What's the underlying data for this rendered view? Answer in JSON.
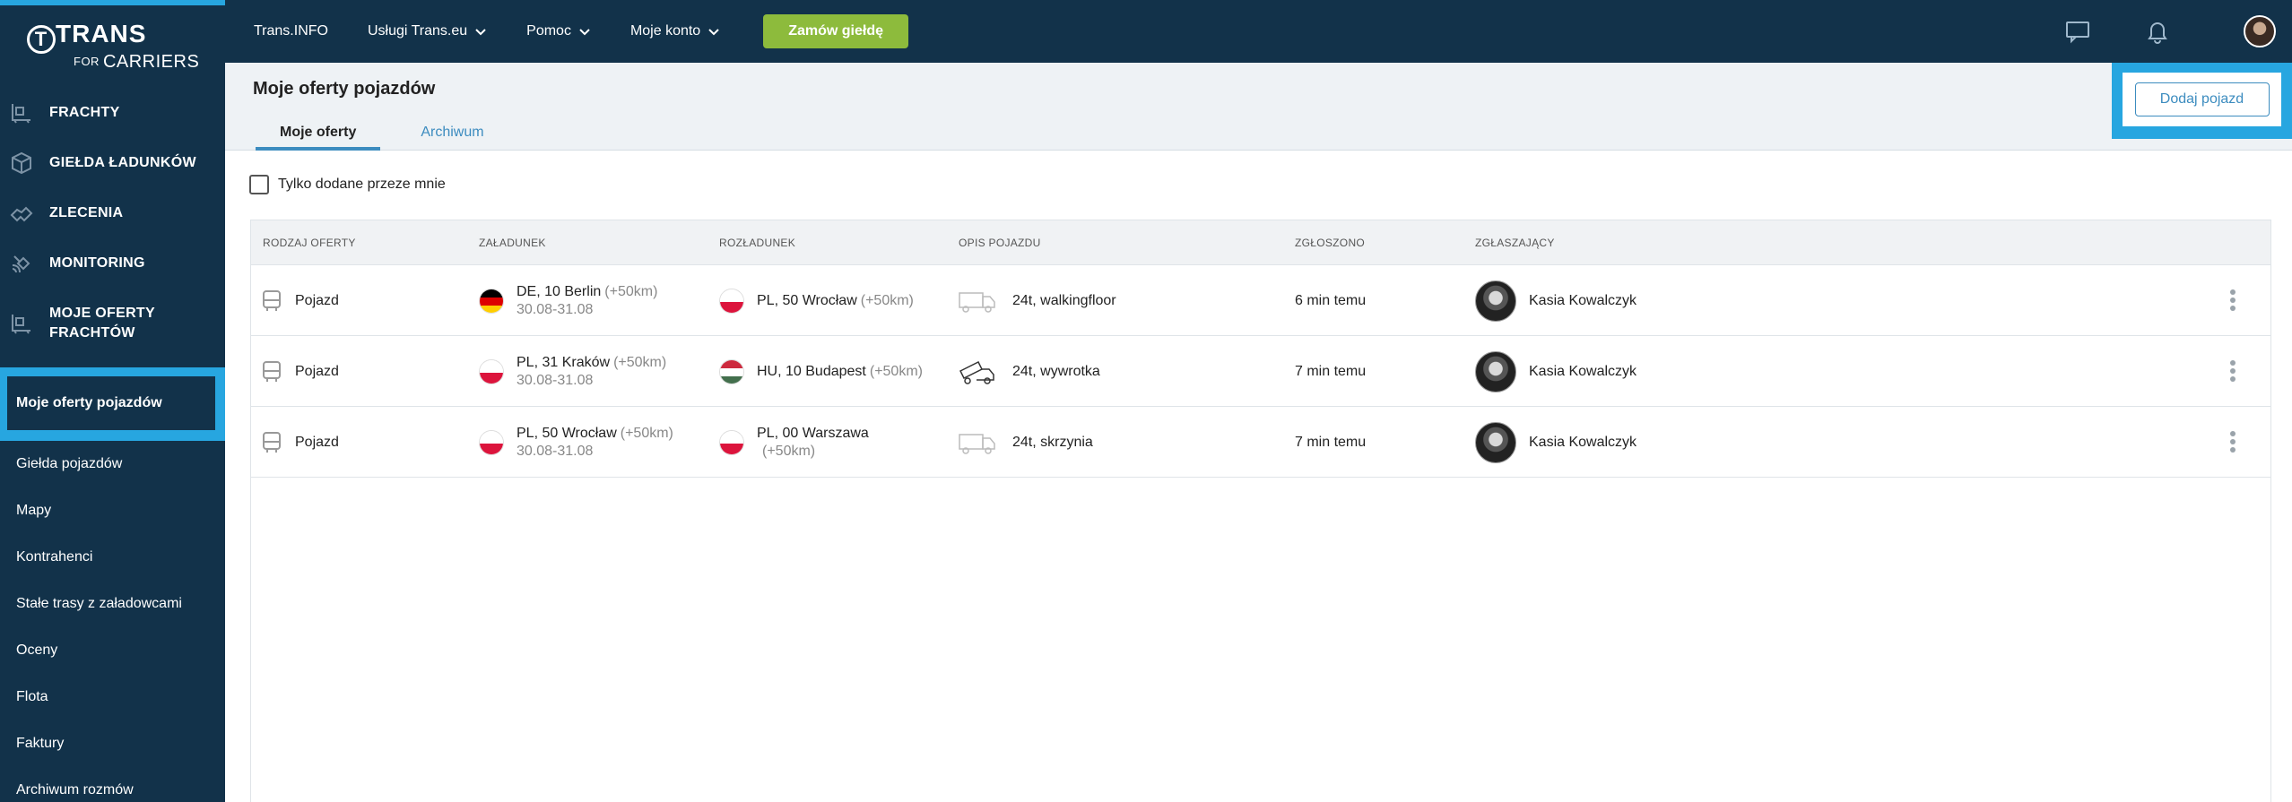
{
  "logo": {
    "brand": "TRANS",
    "sub_small": "FOR",
    "sub_big": "CARRIERS"
  },
  "sidebar": {
    "main_items": [
      {
        "label": "FRACHTY",
        "icon": "cargo-icon"
      },
      {
        "label": "GIEŁDA ŁADUNKÓW",
        "icon": "box-icon"
      },
      {
        "label": "ZLECENIA",
        "icon": "handshake-icon"
      },
      {
        "label": "MONITORING",
        "icon": "satellite-icon"
      },
      {
        "label_line1": "MOJE OFERTY",
        "label_line2": "FRACHTÓW",
        "icon": "cargo-offer-icon"
      }
    ],
    "sub_items": [
      {
        "label": "Moje oferty pojazdów",
        "active": true
      },
      {
        "label": "Giełda pojazdów"
      },
      {
        "label": "Mapy"
      },
      {
        "label": "Kontrahenci"
      },
      {
        "label": "Stałe trasy z załadowcami"
      },
      {
        "label": "Oceny"
      },
      {
        "label": "Flota"
      },
      {
        "label": "Faktury"
      },
      {
        "label": "Archiwum rozmów"
      }
    ]
  },
  "topbar": {
    "links": [
      {
        "label": "Trans.INFO"
      },
      {
        "label": "Usługi Trans.eu"
      },
      {
        "label": "Pomoc"
      },
      {
        "label": "Moje konto"
      }
    ],
    "order_button": "Zamów giełdę",
    "icons": [
      "chat-icon",
      "bell-icon",
      "user-avatar"
    ]
  },
  "page": {
    "title": "Moje oferty pojazdów",
    "tabs": [
      {
        "label": "Moje oferty",
        "active": true
      },
      {
        "label": "Archiwum"
      }
    ],
    "add_button": "Dodaj pojazd",
    "filter_label": "Tylko dodane przeze mnie"
  },
  "table": {
    "headers": [
      "RODZAJ OFERTY",
      "ZAŁADUNEK",
      "ROZŁADUNEK",
      "OPIS POJAZDU",
      "ZGŁOSZONO",
      "ZGŁASZAJĄCY"
    ],
    "rows": [
      {
        "type": "Pojazd",
        "load": {
          "flag": "DE",
          "place": "DE, 10 Berlin",
          "range": "(+50km)",
          "date": "30.08-31.08"
        },
        "unload": {
          "flag": "PL",
          "place": "PL, 50 Wrocław",
          "range": "(+50km)"
        },
        "vehicle": "24t, walkingfloor",
        "vehicle_icon": "truck-icon",
        "reported": "6 min temu",
        "reporter": "Kasia Kowalczyk"
      },
      {
        "type": "Pojazd",
        "load": {
          "flag": "PL",
          "place": "PL, 31 Kraków",
          "range": "(+50km)",
          "date": "30.08-31.08"
        },
        "unload": {
          "flag": "HU",
          "place": "HU, 10 Budapest",
          "range": "(+50km)"
        },
        "vehicle": "24t, wywrotka",
        "vehicle_icon": "tipper-truck-icon",
        "reported": "7 min temu",
        "reporter": "Kasia Kowalczyk"
      },
      {
        "type": "Pojazd",
        "load": {
          "flag": "PL",
          "place": "PL, 50 Wrocław",
          "range": "(+50km)",
          "date": "30.08-31.08"
        },
        "unload": {
          "flag": "PL",
          "place": "PL, 00 Warszawa",
          "range": "(+50km)"
        },
        "vehicle": "24t, skrzynia",
        "vehicle_icon": "truck-icon",
        "reported": "7 min temu",
        "reporter": "Kasia Kowalczyk"
      }
    ]
  },
  "colors": {
    "navy": "#12324a",
    "highlight": "#27a6e0",
    "accent_green": "#8dbb3c",
    "link_blue": "#3c8cbf"
  }
}
